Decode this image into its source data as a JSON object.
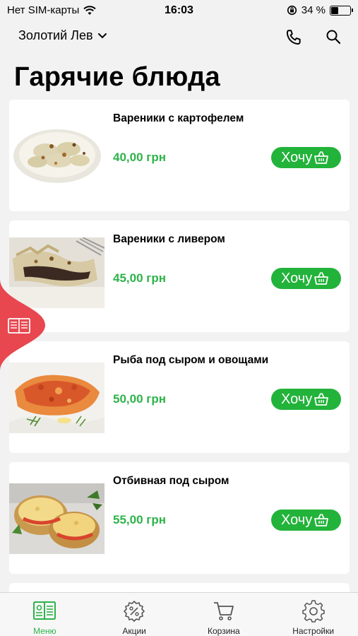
{
  "status_bar": {
    "carrier": "Нет SIM-карты",
    "time": "16:03",
    "battery_percent": "34 %",
    "battery_level": 0.34
  },
  "header": {
    "restaurant": "Золотий Лев"
  },
  "page_title": "Гарячие блюда",
  "dishes": [
    {
      "name": "Вареники с картофелем",
      "price": "40,00 грн",
      "button": "Хочу"
    },
    {
      "name": "Вареники с ливером",
      "price": "45,00 грн",
      "button": "Хочу"
    },
    {
      "name": "Рыба под сыром и овощами",
      "price": "50,00 грн",
      "button": "Хочу"
    },
    {
      "name": "Отбивная под сыром",
      "price": "55,00 грн",
      "button": "Хочу"
    }
  ],
  "tabs": [
    {
      "label": "Меню",
      "icon": "menu-book-icon",
      "active": true
    },
    {
      "label": "Акции",
      "icon": "discount-badge-icon",
      "active": false
    },
    {
      "label": "Корзина",
      "icon": "cart-icon",
      "active": false
    },
    {
      "label": "Настройки",
      "icon": "gear-icon",
      "active": false
    }
  ],
  "colors": {
    "accent": "#2db34a",
    "side_tab": "#e8474f"
  }
}
